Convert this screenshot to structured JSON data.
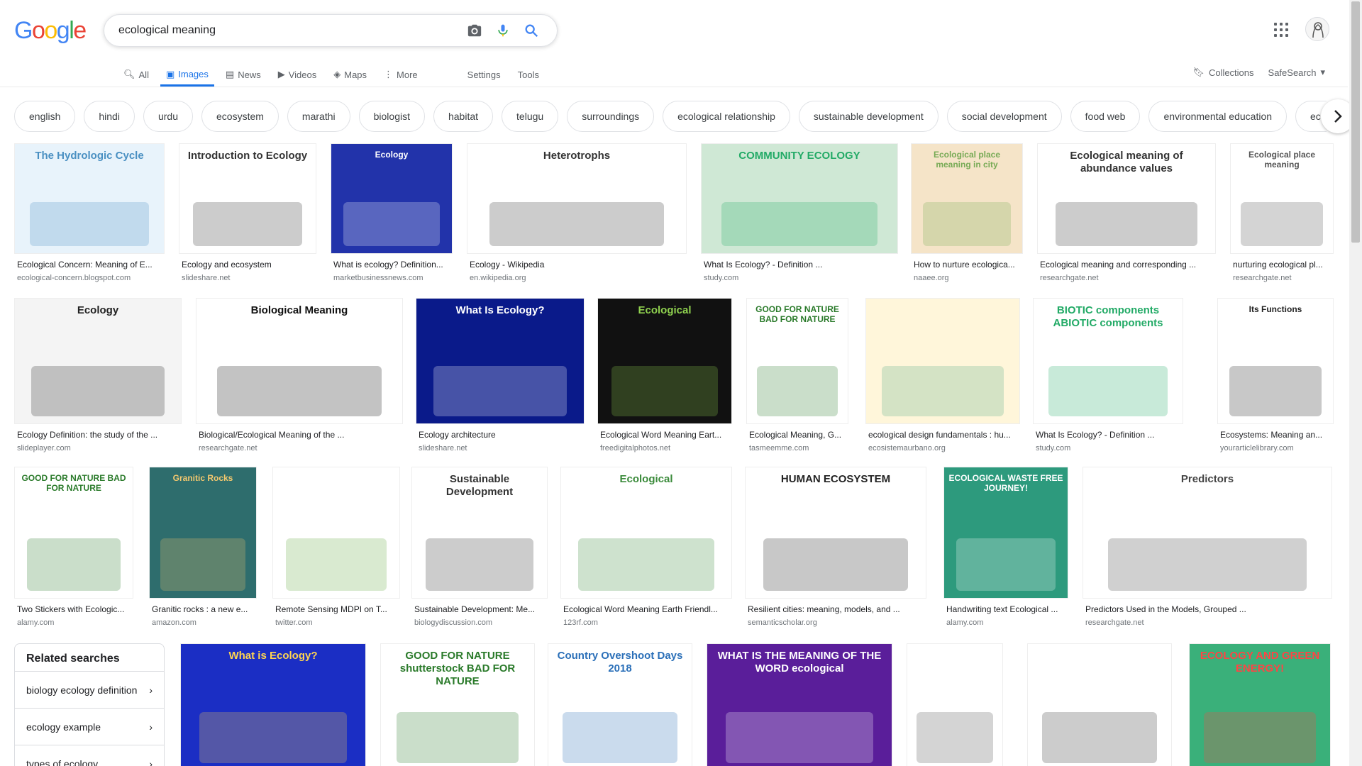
{
  "header": {
    "logo": [
      "G",
      "o",
      "o",
      "g",
      "l",
      "e"
    ],
    "query": "ecological meaning",
    "search_icons": [
      "camera-icon",
      "mic-icon",
      "search-icon"
    ]
  },
  "tabs": [
    {
      "label": "All",
      "icon": "search-icon",
      "active": false
    },
    {
      "label": "Images",
      "icon": "image-icon",
      "active": true
    },
    {
      "label": "News",
      "icon": "news-icon",
      "active": false
    },
    {
      "label": "Videos",
      "icon": "video-icon",
      "active": false
    },
    {
      "label": "Maps",
      "icon": "map-icon",
      "active": false
    },
    {
      "label": "More",
      "icon": "more-icon",
      "active": false
    }
  ],
  "tools": {
    "settings": "Settings",
    "tools": "Tools"
  },
  "right_tabs": {
    "collections": "Collections",
    "safesearch": "SafeSearch"
  },
  "chips": [
    "english",
    "hindi",
    "urdu",
    "ecosystem",
    "marathi",
    "biologist",
    "habitat",
    "telugu",
    "surroundings",
    "ecological relationship",
    "sustainable development",
    "social development",
    "food web",
    "environmental education",
    "economic d"
  ],
  "rows": [
    [
      {
        "caption": "Ecological Concern: Meaning of E...",
        "source": "ecological-concern.blogspot.com",
        "thumb_text": "The Hydrologic Cycle"
      },
      {
        "caption": "Ecology and ecosystem",
        "source": "slideshare.net",
        "thumb_text": "Introduction to Ecology"
      },
      {
        "caption": "What is ecology? Definition...",
        "source": "marketbusinessnews.com",
        "thumb_text": "Ecology"
      },
      {
        "caption": "Ecology - Wikipedia",
        "source": "en.wikipedia.org",
        "thumb_text": "Heterotrophs"
      },
      {
        "caption": "What Is Ecology? - Definition ...",
        "source": "study.com",
        "thumb_text": "COMMUNITY ECOLOGY"
      },
      {
        "caption": "How to nurture ecologica...",
        "source": "naaee.org",
        "thumb_text": "Ecological place meaning in city"
      },
      {
        "caption": "Ecological meaning and corresponding ...",
        "source": "researchgate.net",
        "thumb_text": "Ecological meaning of abundance values"
      },
      {
        "caption": "nurturing ecological pl...",
        "source": "researchgate.net",
        "thumb_text": "Ecological place meaning"
      }
    ],
    [
      {
        "caption": "Ecology Definition: the study of the ...",
        "source": "slideplayer.com",
        "thumb_text": "Ecology"
      },
      {
        "caption": "Biological/Ecological Meaning of the ...",
        "source": "researchgate.net",
        "thumb_text": "Biological Meaning"
      },
      {
        "caption": "Ecology architecture",
        "source": "slideshare.net",
        "thumb_text": "What Is Ecology?"
      },
      {
        "caption": "Ecological Word Meaning Eart...",
        "source": "freedigitalphotos.net",
        "thumb_text": "Ecological"
      },
      {
        "caption": "Ecological Meaning, G...",
        "source": "tasmeemme.com",
        "thumb_text": "GOOD FOR NATURE BAD FOR NATURE"
      },
      {
        "caption": "ecological design fundamentals : hu...",
        "source": "ecosistemaurbano.org",
        "thumb_text": ""
      },
      {
        "caption": "What Is Ecology? - Definition ...",
        "source": "study.com",
        "thumb_text": "BIOTIC components ABIOTIC components"
      },
      {
        "caption": "Ecosystems: Meaning an...",
        "source": "yourarticlelibrary.com",
        "thumb_text": "Its Functions"
      }
    ],
    [
      {
        "caption": "Two Stickers with Ecologic...",
        "source": "alamy.com",
        "thumb_text": "GOOD FOR NATURE BAD FOR NATURE"
      },
      {
        "caption": "Granitic rocks : a new e...",
        "source": "amazon.com",
        "thumb_text": "Granitic Rocks"
      },
      {
        "caption": "Remote Sensing MDPI on T...",
        "source": "twitter.com",
        "thumb_text": ""
      },
      {
        "caption": "Sustainable Development: Me...",
        "source": "biologydiscussion.com",
        "thumb_text": "Sustainable Development"
      },
      {
        "caption": "Ecological Word Meaning Earth Friendl...",
        "source": "123rf.com",
        "thumb_text": "Ecological"
      },
      {
        "caption": "Resilient cities: meaning, models, and ...",
        "source": "semanticscholar.org",
        "thumb_text": "HUMAN ECOSYSTEM"
      },
      {
        "caption": "Handwriting text Ecological ...",
        "source": "alamy.com",
        "thumb_text": "ECOLOGICAL WASTE FREE JOURNEY!"
      },
      {
        "caption": "Predictors Used in the Models, Grouped ...",
        "source": "researchgate.net",
        "thumb_text": "Predictors"
      }
    ],
    [
      {
        "caption": "",
        "source": "",
        "thumb_text": "What is Ecology?"
      },
      {
        "caption": "",
        "source": "",
        "thumb_text": "GOOD FOR NATURE shutterstock BAD FOR NATURE"
      },
      {
        "caption": "",
        "source": "",
        "thumb_text": "Country Overshoot Days 2018"
      },
      {
        "caption": "",
        "source": "",
        "thumb_text": "WHAT IS THE MEANING OF THE WORD ecological"
      },
      {
        "caption": "",
        "source": "",
        "thumb_text": ""
      },
      {
        "caption": "",
        "source": "",
        "thumb_text": ""
      },
      {
        "caption": "",
        "source": "",
        "thumb_text": "ECOLOGY AND GREEN ENERGY!"
      }
    ]
  ],
  "related": {
    "title": "Related searches",
    "items": [
      "biology ecology definition",
      "ecology example",
      "types of ecology"
    ]
  },
  "colors": {
    "accent": "#1a73e8",
    "border": "#dfe1e5",
    "muted": "#70757a"
  }
}
